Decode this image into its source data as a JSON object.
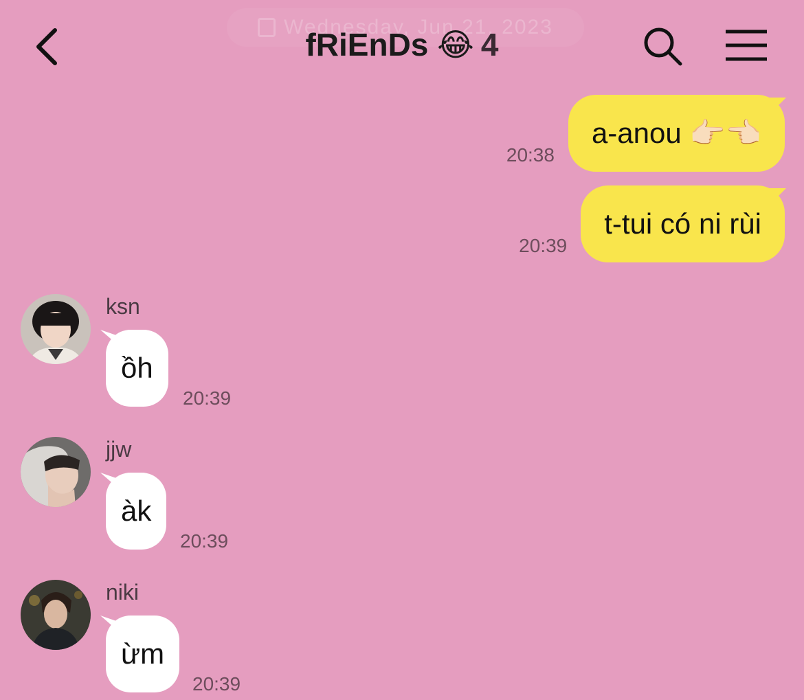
{
  "header": {
    "date_overlay": "Wednesday, Jun 21, 2023",
    "title": "fRiEnDs 😂",
    "member_count": "4",
    "icons": {
      "back": "chevron-left-icon",
      "search": "search-icon",
      "menu": "hamburger-menu-icon"
    }
  },
  "outgoing_messages": [
    {
      "text": "a-anou 👉🏻👈🏻",
      "time": "20:38"
    },
    {
      "text": "t-tui có ni rùi",
      "time": "20:39"
    }
  ],
  "incoming_messages": [
    {
      "sender": "ksn",
      "text": "ồh",
      "time": "20:39"
    },
    {
      "sender": "jjw",
      "text": "àk",
      "time": "20:39"
    },
    {
      "sender": "niki",
      "text": "ừm",
      "time": "20:39"
    }
  ],
  "colors": {
    "background": "#e59dbf",
    "outgoing_bubble": "#f9e54c",
    "incoming_bubble": "#ffffff"
  }
}
